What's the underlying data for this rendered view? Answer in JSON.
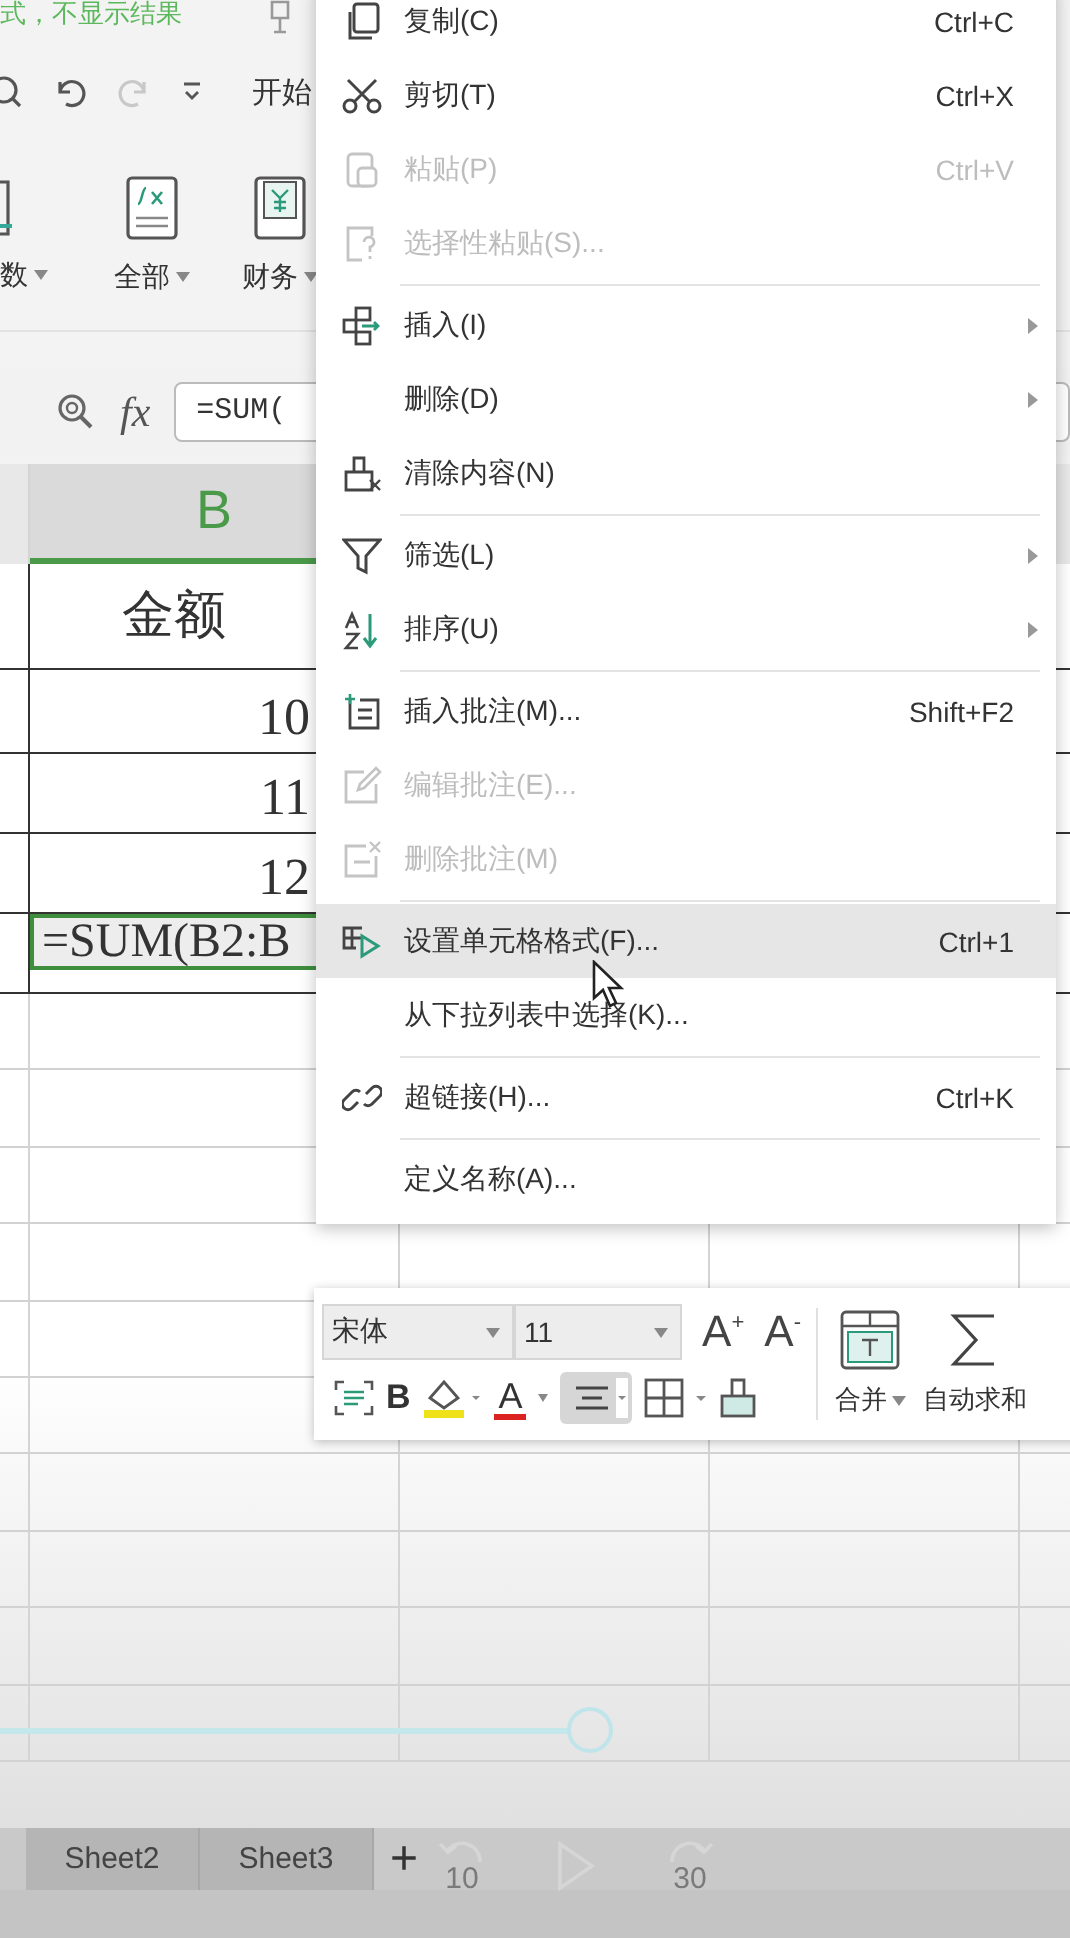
{
  "top_hint": "式，不显示结果",
  "quick_toolbar": {
    "tab": "开始",
    "redo": {
      "disabled": true
    }
  },
  "ribbon": {
    "buttons": [
      {
        "label": "数",
        "kind": "partial"
      },
      {
        "label": "全部",
        "kind": "formula"
      },
      {
        "label": "财务",
        "kind": "finance"
      }
    ]
  },
  "formula_bar": {
    "fx": "fx",
    "value": "=SUM("
  },
  "sheet": {
    "column_header": "B",
    "cells": [
      {
        "value": "金额",
        "kind": "header",
        "selected": false
      },
      {
        "value": "10",
        "kind": "number",
        "selected": false
      },
      {
        "value": "11",
        "kind": "number",
        "selected": false
      },
      {
        "value": "12",
        "kind": "number",
        "selected": false
      },
      {
        "value": "=SUM(B2:B",
        "kind": "formula",
        "selected": true
      }
    ]
  },
  "context_menu": {
    "items": [
      {
        "label": "复制(C)",
        "shortcut": "Ctrl+C",
        "kind": "copy",
        "disabled": false,
        "submenu": false,
        "highlighted": false,
        "separator_before": false
      },
      {
        "label": "剪切(T)",
        "shortcut": "Ctrl+X",
        "kind": "cut",
        "disabled": false,
        "submenu": false,
        "highlighted": false,
        "separator_before": false
      },
      {
        "label": "粘贴(P)",
        "shortcut": "Ctrl+V",
        "kind": "paste",
        "disabled": true,
        "submenu": false,
        "highlighted": false,
        "separator_before": false
      },
      {
        "label": "选择性粘贴(S)...",
        "kind": "paste-special",
        "disabled": true,
        "submenu": false,
        "highlighted": false,
        "separator_before": false
      },
      {
        "label": "插入(I)",
        "kind": "insert",
        "disabled": false,
        "submenu": true,
        "highlighted": false,
        "separator_before": true
      },
      {
        "label": "删除(D)",
        "kind": "plain",
        "disabled": false,
        "submenu": true,
        "highlighted": false,
        "separator_before": false
      },
      {
        "label": "清除内容(N)",
        "kind": "clear",
        "disabled": false,
        "submenu": false,
        "highlighted": false,
        "separator_before": false
      },
      {
        "label": "筛选(L)",
        "kind": "filter",
        "disabled": false,
        "submenu": true,
        "highlighted": false,
        "separator_before": true
      },
      {
        "label": "排序(U)",
        "kind": "sort",
        "disabled": false,
        "submenu": true,
        "highlighted": false,
        "separator_before": false
      },
      {
        "label": "插入批注(M)...",
        "shortcut": "Shift+F2",
        "kind": "comment-insert",
        "disabled": false,
        "submenu": false,
        "highlighted": false,
        "separator_before": true
      },
      {
        "label": "编辑批注(E)...",
        "kind": "comment-edit",
        "disabled": true,
        "submenu": false,
        "highlighted": false,
        "separator_before": false
      },
      {
        "label": "删除批注(M)",
        "kind": "comment-delete",
        "disabled": true,
        "submenu": false,
        "highlighted": false,
        "separator_before": false
      },
      {
        "label": "设置单元格格式(F)...",
        "shortcut": "Ctrl+1",
        "kind": "format",
        "disabled": false,
        "submenu": false,
        "highlighted": true,
        "separator_before": true
      },
      {
        "label": "从下拉列表中选择(K)...",
        "kind": "plain",
        "disabled": false,
        "submenu": false,
        "highlighted": false,
        "separator_before": false
      },
      {
        "label": "超链接(H)...",
        "shortcut": "Ctrl+K",
        "kind": "link",
        "disabled": false,
        "submenu": false,
        "highlighted": false,
        "separator_before": true
      },
      {
        "label": "定义名称(A)...",
        "kind": "plain",
        "disabled": false,
        "submenu": false,
        "highlighted": false,
        "separator_before": true
      }
    ]
  },
  "mini_toolbar": {
    "font": "宋体",
    "size": "11",
    "grow": "A$^{+}$",
    "shrink": "A$^{-}$",
    "bold": "B",
    "font_color": "A",
    "align_pressed": true,
    "merge": "合并",
    "sum": "自动求和"
  },
  "sheet_tabs": [
    {
      "label": "Sheet2",
      "selected": false
    },
    {
      "label": "Sheet3",
      "selected": false
    }
  ],
  "add_sheet": "+",
  "player": {
    "progress": {
      "level": 0.53
    },
    "rewind": "10",
    "forward": "30"
  }
}
